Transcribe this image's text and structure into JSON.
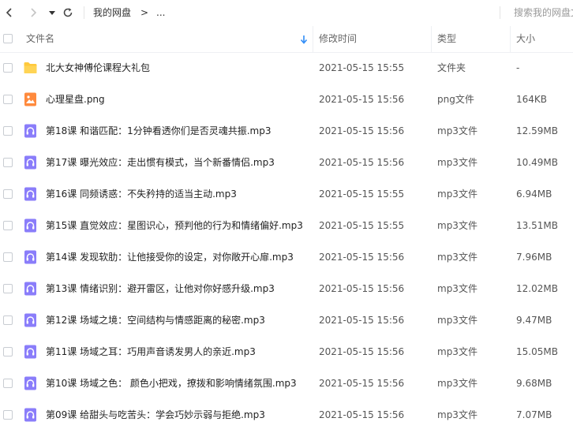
{
  "toolbar": {
    "breadcrumb_root": "我的网盘",
    "breadcrumb_separator": ">",
    "breadcrumb_more": "...",
    "search_placeholder": "搜索我的网盘文件"
  },
  "header": {
    "name": "文件名",
    "modified": "修改时间",
    "type": "类型",
    "size": "大小"
  },
  "colors": {
    "folder": "#ffc93c",
    "image": "#ff8a3d",
    "audio": "#8a7dfa",
    "sort_arrow": "#2f8cf7"
  },
  "files": [
    {
      "name": "北大女神傅伦课程大礼包",
      "date": "2021-05-15 15:55",
      "type": "文件夹",
      "size": "-",
      "icon": "folder-icon"
    },
    {
      "name": "心理星盘.png",
      "date": "2021-05-15 15:56",
      "type": "png文件",
      "size": "164KB",
      "icon": "image-file-icon"
    },
    {
      "name": "第18课 和谐匹配：1分钟看透你们是否灵魂共振.mp3",
      "date": "2021-05-15 15:56",
      "type": "mp3文件",
      "size": "12.59MB",
      "icon": "audio-file-icon"
    },
    {
      "name": "第17课 曝光效应：走出惯有模式，当个新番情侣.mp3",
      "date": "2021-05-15 15:56",
      "type": "mp3文件",
      "size": "10.49MB",
      "icon": "audio-file-icon"
    },
    {
      "name": "第16课 同频诱惑：不失矜持的适当主动.mp3",
      "date": "2021-05-15 15:55",
      "type": "mp3文件",
      "size": "6.94MB",
      "icon": "audio-file-icon"
    },
    {
      "name": "第15课 直觉效应：星图识心，预判他的行为和情绪偏好.mp3",
      "date": "2021-05-15 15:55",
      "type": "mp3文件",
      "size": "13.51MB",
      "icon": "audio-file-icon"
    },
    {
      "name": "第14课 发现软肋：让他接受你的设定，对你敞开心扉.mp3",
      "date": "2021-05-15 15:56",
      "type": "mp3文件",
      "size": "7.96MB",
      "icon": "audio-file-icon"
    },
    {
      "name": "第13课 情绪识别：避开雷区，让他对你好感升级.mp3",
      "date": "2021-05-15 15:56",
      "type": "mp3文件",
      "size": "12.02MB",
      "icon": "audio-file-icon"
    },
    {
      "name": "第12课 场域之境：空间结构与情感距离的秘密.mp3",
      "date": "2021-05-15 15:56",
      "type": "mp3文件",
      "size": "9.47MB",
      "icon": "audio-file-icon"
    },
    {
      "name": "第11课 场域之耳：巧用声音诱发男人的亲近.mp3",
      "date": "2021-05-15 15:56",
      "type": "mp3文件",
      "size": "15.05MB",
      "icon": "audio-file-icon"
    },
    {
      "name": "第10课 场域之色： 颜色小把戏，撩拨和影响情绪氛围.mp3",
      "date": "2021-05-15 15:56",
      "type": "mp3文件",
      "size": "9.68MB",
      "icon": "audio-file-icon"
    },
    {
      "name": "第09课 给甜头与吃苦头：学会巧妙示弱与拒绝.mp3",
      "date": "2021-05-15 15:56",
      "type": "mp3文件",
      "size": "7.07MB",
      "icon": "audio-file-icon"
    }
  ]
}
